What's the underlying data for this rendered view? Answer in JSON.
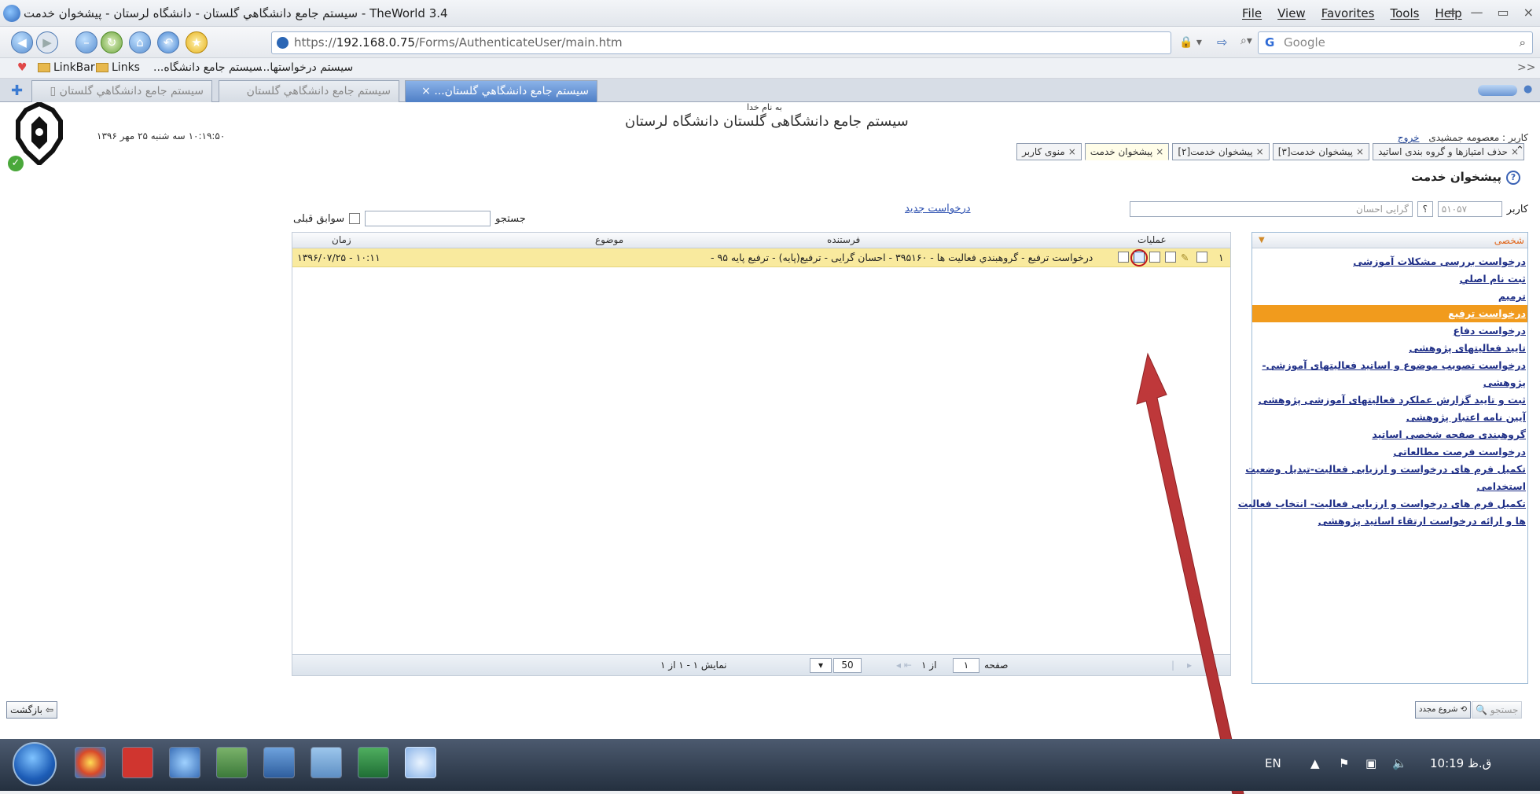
{
  "window": {
    "title": "TheWorld 3.4 - سیستم جامع دانشگاهي گلستان - دانشگاه لرستان - پیشخوان خدمت",
    "menu": [
      "File",
      "View",
      "Favorites",
      "Tools",
      "Help"
    ],
    "controls": [
      "=",
      "—",
      "▭",
      "×"
    ]
  },
  "navbar": {
    "url_prefix": "https://",
    "url_host": "192.168.0.75",
    "url_path": "/Forms/AuthenticateUser/main.htm",
    "search_placeholder": "Google",
    "search_engine": "G"
  },
  "bookmarks": {
    "items": [
      "LinkBar",
      "Links",
      "سیستم جامع دانشگاه...",
      "سیستم درخواستها...",
      ">>"
    ]
  },
  "tabs": {
    "items": [
      {
        "label": "سیستم جامع دانشگاهي گلستان",
        "active": false
      },
      {
        "label": "سیستم جامع دانشگاهي گلستان",
        "active": false
      },
      {
        "label": "سیستم جامع دانشگاهي گلستان...",
        "active": true
      }
    ]
  },
  "header": {
    "bismillah": "به نام خدا",
    "system_title": "سیستم جامع دانشگاهی گلستان   دانشگاه لرستان",
    "datetime": "۱۰:۱۹:۵۰ سه شنبه ۲۵ مهر ۱۳۹۶",
    "user_label": "کاربر : معصومه جمشیدی",
    "logout_label": "خروج",
    "page_title": "پیشخوان خدمت"
  },
  "portal_tabs": [
    {
      "label": "منوی کاربر",
      "active": false
    },
    {
      "label": "پیشخوان خدمت",
      "active": true
    },
    {
      "label": "پیشخوان خدمت[۲]",
      "active": false
    },
    {
      "label": "پیشخوان خدمت[۳]",
      "active": false
    },
    {
      "label": "حذف امتیازها و گروه بندی اساتید",
      "active": false
    }
  ],
  "filter": {
    "user_label": "کاربر",
    "user_code": "۵۱۰۵۷",
    "user_help": "؟",
    "user_name": "گرایی احسان",
    "new_request": "درخواست جدید",
    "search_label": "جستجو",
    "search_value": "",
    "history_label": "سوابق قبلی"
  },
  "grid": {
    "columns": {
      "ops": "عملیات",
      "sender": "فرستنده",
      "subject": "موضوع",
      "time": "زمان"
    },
    "rows": [
      {
        "index": "۱",
        "subject": "درخواست ترفیع - گروهبندي فعالیت ها - ۳۹۵۱۶۰ - احسان گرایی - ترفیع(پایه) - ترفیع پایه ۹۵ -",
        "time": "۱۰:۱۱ - ۱۳۹۶/۰۷/۲۵",
        "sender": ""
      }
    ],
    "pager": {
      "page_label": "صفحه",
      "page_value": "۱",
      "of_label": "از ۱",
      "page_size": "50",
      "showing": "نمایش ۱ - ۱ از ۱"
    }
  },
  "sidebar": {
    "header": "شخصی",
    "items": [
      {
        "label": "درخواست بررسی مشکلات آموزشی",
        "selected": false
      },
      {
        "label": "ثبت نام اصلي",
        "selected": false
      },
      {
        "label": "ترمیم",
        "selected": false
      },
      {
        "label": "درخواست ترفیع",
        "selected": true
      },
      {
        "label": "درخواست دفاع",
        "selected": false
      },
      {
        "label": "تایید فعالیتهای پژوهشی",
        "selected": false
      },
      {
        "label": "درخواست تصویب موضوع و اساتید فعالیتهای آموزشی-",
        "selected": false
      },
      {
        "label": "پژوهشی",
        "selected": false
      },
      {
        "label": "ثبت و تایید گزارش عملکرد فعالیتهای آموزشی پژوهشی",
        "selected": false
      },
      {
        "label": "آیین نامه اعتبار پژوهشی",
        "selected": false
      },
      {
        "label": "گروهبندی صفحه شخصی اساتید",
        "selected": false
      },
      {
        "label": "درخواست فرصت مطالعاتی",
        "selected": false
      },
      {
        "label": "تکمیل فرم های درخواست و ارزیابی فعالیت-تبدیل وضعیت",
        "selected": false
      },
      {
        "label": "استخدامی",
        "selected": false
      },
      {
        "label": "تکمیل فرم های درخواست و ارزیابی فعالیت- انتخاب فعالیت",
        "selected": false
      },
      {
        "label": "ها و ارائه درخواست ارتقاء اساتید پژوهشی",
        "selected": false
      }
    ]
  },
  "buttons": {
    "back": "بازگشت",
    "restart": "شروع مجدد",
    "search": "جستجو"
  },
  "tray": {
    "lang": "EN",
    "time": "10:19 ق.ظ"
  },
  "colors": {
    "selected_row": "#f9ea9e",
    "sidebar_selected": "#f19b1d",
    "annotation_arrow": "#c0393b",
    "link": "#1f2f87"
  }
}
